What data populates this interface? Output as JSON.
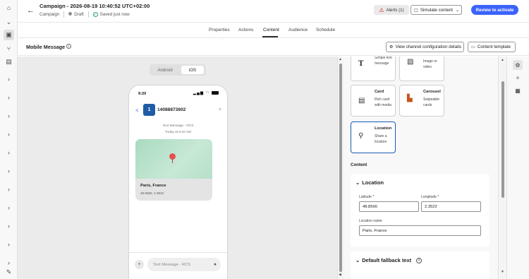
{
  "header": {
    "title": "Campaign - 2026-08-19 10:40:52 UTC+02:00",
    "type": "Campaign",
    "status": "Draft",
    "saved": "Saved just now",
    "alerts_label": "Alerts (1)",
    "simulate_label": "Simulate content",
    "review_label": "Review to activate"
  },
  "tabs": [
    "Properties",
    "Actions",
    "Content",
    "Audience",
    "Schedule"
  ],
  "active_tab": "Content",
  "subheader": {
    "title": "Mobile Message",
    "view_config_label": "View channel configuration details",
    "content_template_label": "Content template"
  },
  "preview": {
    "platforms": [
      "Android",
      "iOS"
    ],
    "active_platform": "iOS",
    "status_time": "9:20",
    "avatar_text": "1",
    "phone_number": "14088873602",
    "message_type": "Text Message - RCS",
    "message_time": "Today at 9:20 AM",
    "location_name": "Paris, France",
    "location_coords": "48.8566, 2.3522",
    "composer_placeholder": "Text Message - RCS"
  },
  "templates": [
    {
      "title": "",
      "desc": "Simple text message",
      "icon": "text-icon"
    },
    {
      "title": "",
      "desc": "Image or video",
      "icon": "image-icon"
    },
    {
      "title": "Card",
      "desc": "Rich card with media",
      "icon": "card-icon"
    },
    {
      "title": "Carousel",
      "desc": "Swipeable cards",
      "icon": "carousel-icon"
    },
    {
      "title": "Location",
      "desc": "Share a location",
      "icon": "location-pin-icon",
      "selected": true
    }
  ],
  "content": {
    "label": "Content",
    "location_section": "Location",
    "latitude_label": "Latitude",
    "latitude_value": "48.8566",
    "longitude_label": "Longitude",
    "longitude_value": "2.3522",
    "required_marker": "*",
    "location_name_label": "Location name",
    "location_name_value": "Paris, France",
    "fallback_section": "Default fallback text"
  },
  "colors": {
    "accent": "#3b63fb",
    "avatar": "#1f5ca6",
    "selected_tile": "#1a57b3",
    "map": "#b6dfc8",
    "pin": "#e3514e",
    "alert": "#d31510",
    "saved": "#2d9d78"
  }
}
